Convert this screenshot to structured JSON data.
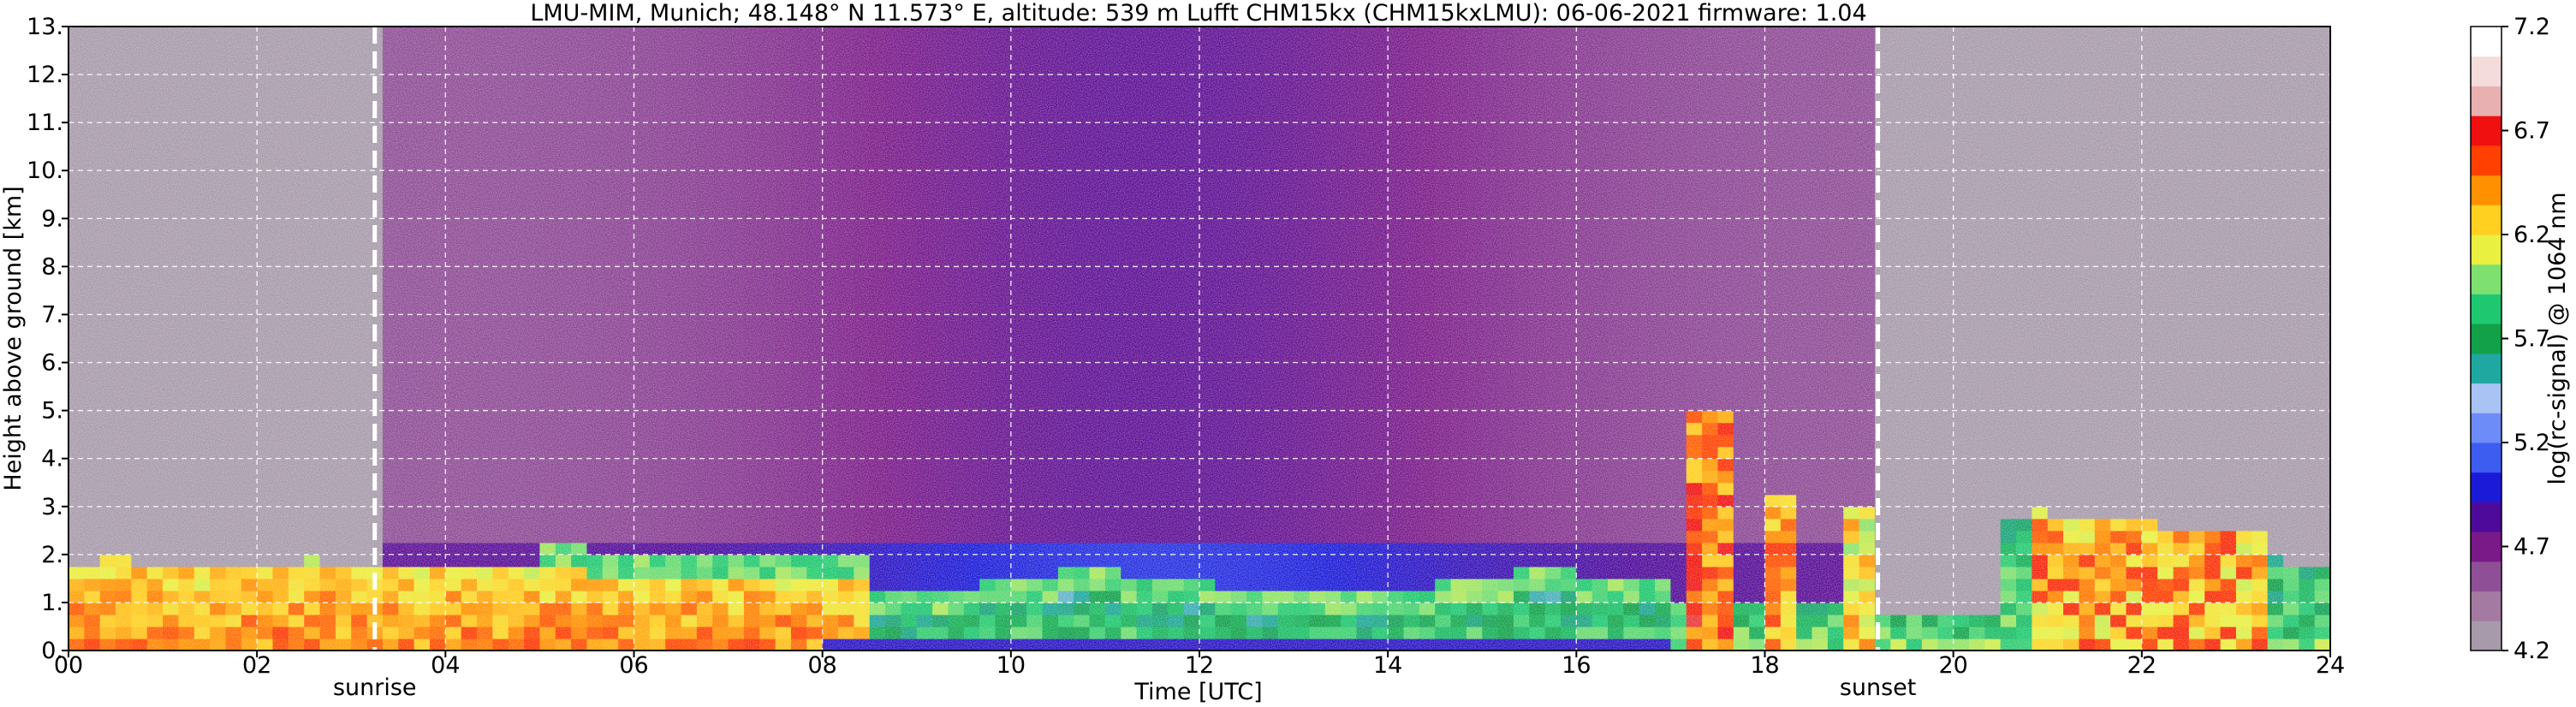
{
  "chart_data": {
    "type": "heatmap",
    "title": "LMU-MIM, Munich; 48.148° N 11.573° E, altitude: 539 m    Lufft CHM15kx (CHM15kxLMU): 06-06-2021    firmware: 1.04",
    "xlabel": "Time [UTC]",
    "ylabel": "Height above ground [km]",
    "xlim": [
      0,
      24
    ],
    "ylim": [
      0,
      13
    ],
    "x_ticks": [
      "00",
      "02",
      "04",
      "06",
      "08",
      "10",
      "12",
      "14",
      "16",
      "18",
      "20",
      "22",
      "24"
    ],
    "y_ticks": [
      "0.",
      "1.",
      "2.",
      "3.",
      "4.",
      "5.",
      "6.",
      "7.",
      "8.",
      "9.",
      "10.",
      "11.",
      "12.",
      "13."
    ],
    "grid": true,
    "colorbar": {
      "label": "log(rc-signal) @ 1064 nm",
      "range": [
        4.2,
        7.2
      ],
      "ticks": [
        "4.2",
        "4.7",
        "5.2",
        "5.7",
        "6.2",
        "6.7",
        "7.2"
      ],
      "colors": [
        "#a79aaa",
        "#a57aa2",
        "#8f4f96",
        "#7a1a88",
        "#4e0a9a",
        "#1a1ad8",
        "#3d5cf0",
        "#6e8cf8",
        "#a9c3f5",
        "#1fa8a0",
        "#12a048",
        "#1ec870",
        "#7ee070",
        "#e9f040",
        "#ffd020",
        "#ff9000",
        "#ff4000",
        "#f01010",
        "#e8b0b0",
        "#f4dcdc",
        "#ffffff"
      ]
    },
    "annotations": [
      {
        "text": "sunrise",
        "x": 3.25
      },
      {
        "text": "sunset",
        "x": 19.2
      }
    ]
  }
}
